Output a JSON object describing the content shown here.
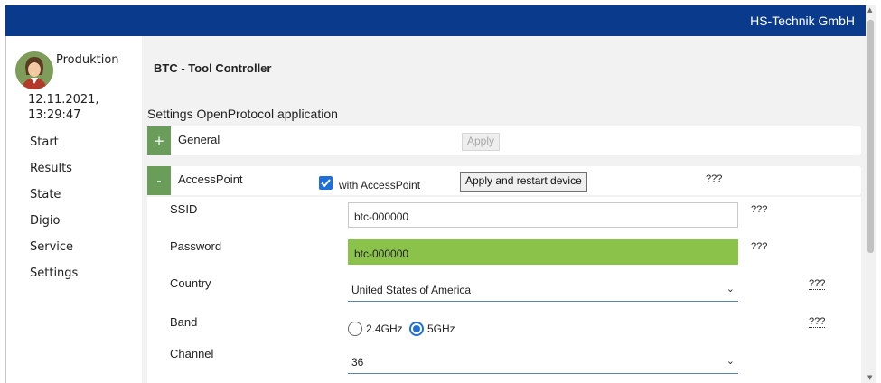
{
  "header": {
    "brand": "HS-Technik GmbH",
    "accent": "#0a3a8c"
  },
  "sidebar": {
    "user": "Produktion",
    "datetime": "12.11.2021,\n13:29:47",
    "items": [
      {
        "label": "Start"
      },
      {
        "label": "Results"
      },
      {
        "label": "State"
      },
      {
        "label": "Digio"
      },
      {
        "label": "Service"
      },
      {
        "label": "Settings"
      }
    ]
  },
  "main": {
    "title": "BTC - Tool Controller",
    "subtitle": "Settings OpenProtocol application",
    "general": {
      "toggle": "+",
      "label": "General",
      "apply": "Apply"
    },
    "accesspoint": {
      "toggle": "-",
      "label": "AccessPoint",
      "checkbox_label": "with AccessPoint",
      "checked": true,
      "apply_restart": "Apply and restart device",
      "help": "???"
    },
    "fields": {
      "ssid": {
        "label": "SSID",
        "value": "btc-000000",
        "help": "???"
      },
      "password": {
        "label": "Password",
        "value": "btc-000000",
        "help": "???",
        "highlight": "#8bc34a"
      },
      "country": {
        "label": "Country",
        "value": "United States of America",
        "help": "???"
      },
      "band": {
        "label": "Band",
        "options": [
          "2.4GHz",
          "5GHz"
        ],
        "selected": "5GHz",
        "help": "???"
      },
      "channel": {
        "label": "Channel",
        "value": "36"
      }
    }
  }
}
